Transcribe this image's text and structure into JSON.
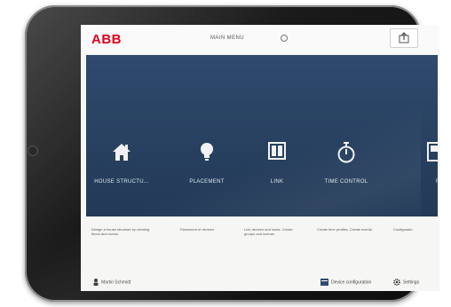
{
  "header": {
    "logo": "ABB",
    "title": "MAIN MENU"
  },
  "tiles": [
    {
      "label": "HOUSE STRUCTU...",
      "icon": "house-icon",
      "description": "Design a house structure by creating floors and rooms."
    },
    {
      "label": "PLACEMENT",
      "icon": "lightbulb-icon",
      "description": "Placement of devices"
    },
    {
      "label": "LINK",
      "icon": "link-icon",
      "description": "Link devices and loads. Create groups and scenes."
    },
    {
      "label": "TIME CONTROL",
      "icon": "timer-icon",
      "description": "Create time profiles. Create events."
    },
    {
      "label": "F",
      "icon": "panel-icon",
      "description": "Configuratio"
    }
  ],
  "footer": {
    "user": "Martin Schmidt",
    "device_config": "Device configuration",
    "settings": "Settings"
  },
  "colors": {
    "brand": "#e2001a",
    "panel": "#2b4466"
  }
}
